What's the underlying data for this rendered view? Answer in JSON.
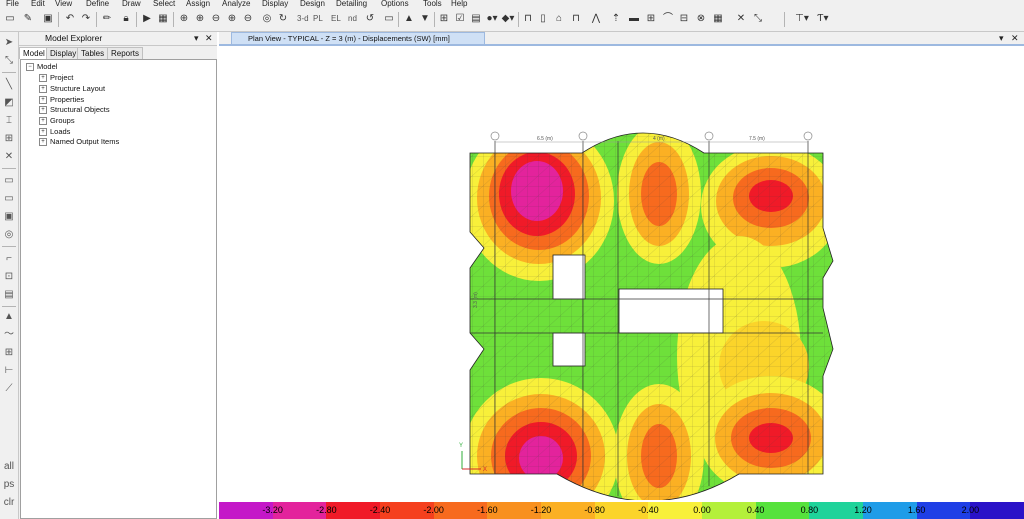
{
  "menu": {
    "items": [
      "File",
      "Edit",
      "View",
      "Define",
      "Draw",
      "Select",
      "Assign",
      "Analyze",
      "Display",
      "Design",
      "Detailing",
      "Options",
      "Tools",
      "Help"
    ]
  },
  "toolbar": {
    "view_3d_label": "3-d",
    "plan_label": "PL",
    "elev_label": "EL",
    "nd_label": "nd"
  },
  "explorer": {
    "title": "Model Explorer",
    "pin_glyph": "▾",
    "close_glyph": "✕",
    "tabs": [
      "Model",
      "Display",
      "Tables",
      "Reports"
    ],
    "root": "Model",
    "items": [
      "Project",
      "Structure Layout",
      "Properties",
      "Structural Objects",
      "Groups",
      "Loads",
      "Named Output Items"
    ]
  },
  "viewport": {
    "tab_title": "Plan View - TYPICAL - Z = 3 (m)  - Displacements (SW)  [mm]",
    "menu_glyph": "▾",
    "close_glyph": "✕",
    "dim_top_left": "6.5 (m)",
    "dim_top_mid": "4 (m)",
    "dim_top_right": "7.5 (m)",
    "dim_left": "3.3 (m)",
    "axis_x": "X",
    "axis_y": "Y"
  },
  "legend": {
    "labels": [
      "-3.20",
      "-2.80",
      "-2.40",
      "-2.00",
      "-1.60",
      "-1.20",
      "-0.80",
      "-0.40",
      "0.00",
      "0.40",
      "0.80",
      "1.20",
      "1.60",
      "2.00"
    ],
    "colors": [
      "#c418c8",
      "#e3239c",
      "#f01a28",
      "#f5401e",
      "#f76a1e",
      "#f8901f",
      "#fbb023",
      "#fbd42a",
      "#f8f03a",
      "#b4f03a",
      "#56e23c",
      "#1fd39a",
      "#1f9ce8",
      "#1f3fe6",
      "#2a12c8"
    ]
  }
}
